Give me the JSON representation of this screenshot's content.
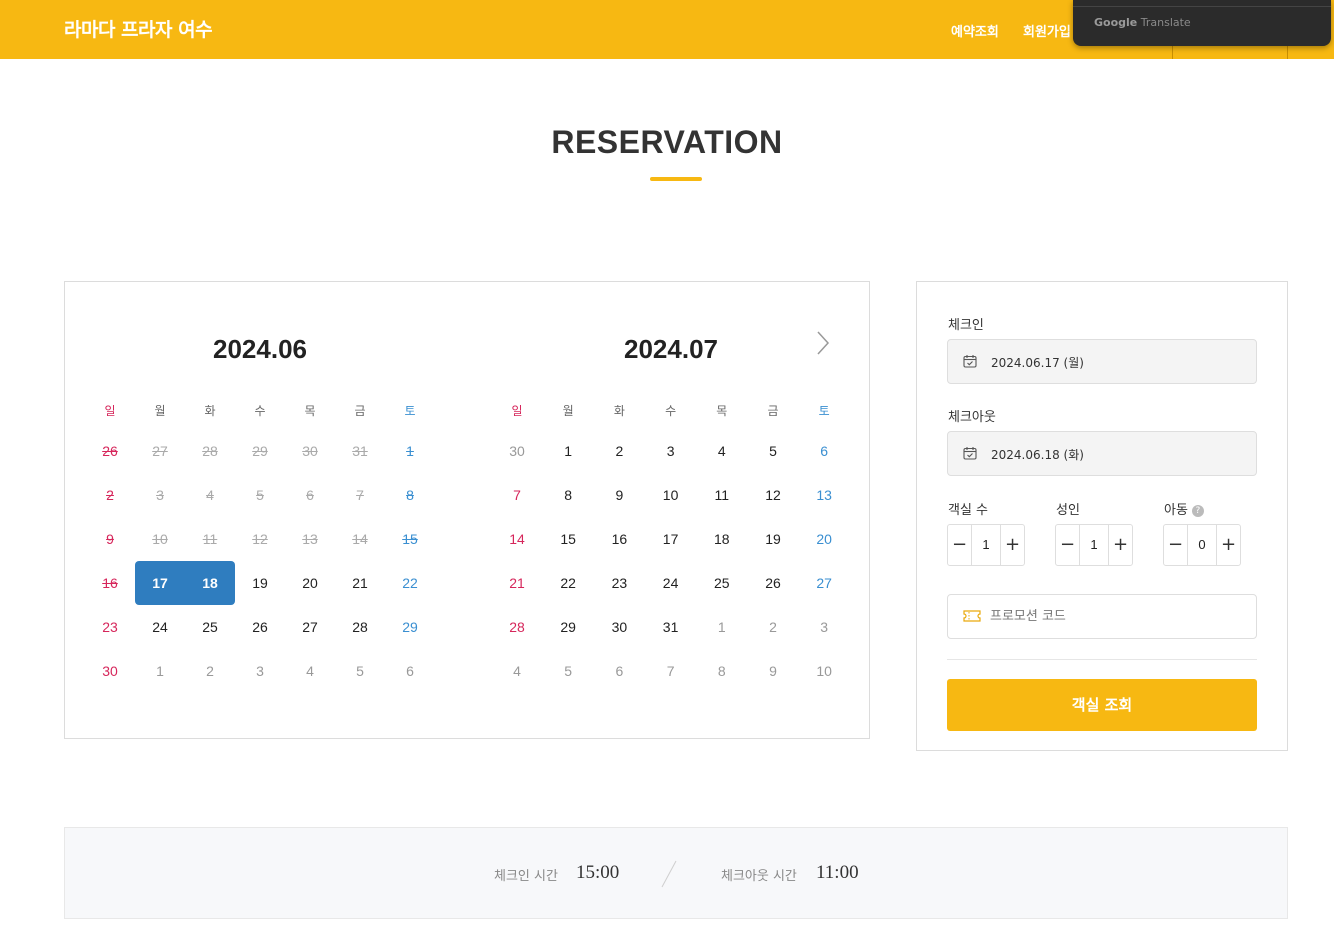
{
  "header": {
    "brand": "라마다 프라자 여수",
    "nav": [
      "예약조회",
      "회원가입"
    ],
    "translate_popup": {
      "google": "Google",
      "translate": "Translate"
    }
  },
  "page": {
    "title": "RESERVATION"
  },
  "calendar": {
    "weekdays": [
      "일",
      "월",
      "화",
      "수",
      "목",
      "금",
      "토"
    ],
    "months": [
      {
        "title": "2024.06",
        "weeks": [
          [
            "26",
            "27",
            "28",
            "29",
            "30",
            "31",
            "1"
          ],
          [
            "2",
            "3",
            "4",
            "5",
            "6",
            "7",
            "8"
          ],
          [
            "9",
            "10",
            "11",
            "12",
            "13",
            "14",
            "15"
          ],
          [
            "16",
            "17",
            "18",
            "19",
            "20",
            "21",
            "22"
          ],
          [
            "23",
            "24",
            "25",
            "26",
            "27",
            "28",
            "29"
          ],
          [
            "30",
            "1",
            "2",
            "3",
            "4",
            "5",
            "6"
          ]
        ]
      },
      {
        "title": "2024.07",
        "weeks": [
          [
            "30",
            "1",
            "2",
            "3",
            "4",
            "5",
            "6"
          ],
          [
            "7",
            "8",
            "9",
            "10",
            "11",
            "12",
            "13"
          ],
          [
            "14",
            "15",
            "16",
            "17",
            "18",
            "19",
            "20"
          ],
          [
            "21",
            "22",
            "23",
            "24",
            "25",
            "26",
            "27"
          ],
          [
            "28",
            "29",
            "30",
            "31",
            "1",
            "2",
            "3"
          ],
          [
            "4",
            "5",
            "6",
            "7",
            "8",
            "9",
            "10"
          ]
        ]
      }
    ],
    "next_icon": "chevron-right-icon",
    "selected": [
      "2024.06.17",
      "2024.06.18"
    ],
    "colors": {
      "sunday": "#d6265b",
      "saturday": "#3a8fd1",
      "selected": "#2f7dbf"
    }
  },
  "booking": {
    "checkin_label": "체크인",
    "checkin_value": "2024.06.17 (월)",
    "checkout_label": "체크아웃",
    "checkout_value": "2024.06.18 (화)",
    "rooms_label": "객실 수",
    "rooms_value": "1",
    "adults_label": "성인",
    "adults_value": "1",
    "children_label": "아동",
    "children_value": "0",
    "help_glyph": "?",
    "minus": "−",
    "plus": "+",
    "promo_placeholder": "프로모션 코드",
    "search_label": "객실 조회",
    "accent": "#f7b812"
  },
  "times": {
    "checkin_label": "체크인 시간",
    "checkin_value": "15:00",
    "checkout_label": "체크아웃 시간",
    "checkout_value": "11:00"
  }
}
